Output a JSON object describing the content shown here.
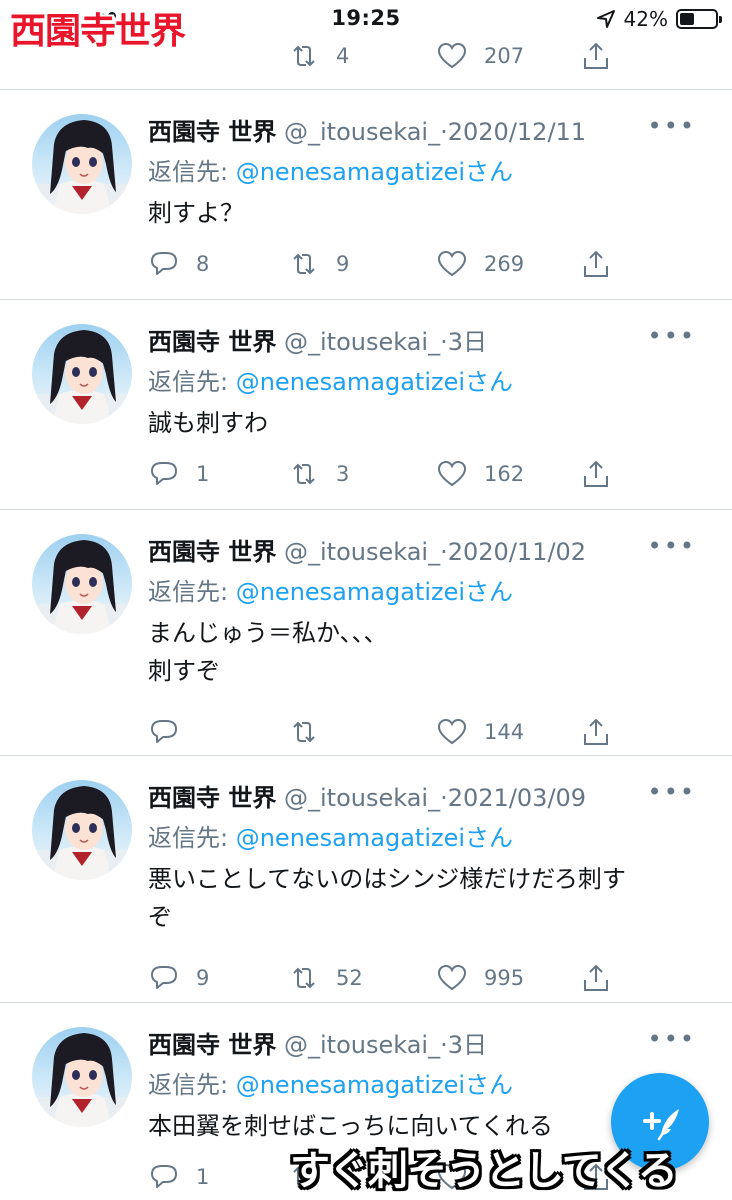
{
  "status_bar": {
    "time": "19:25",
    "battery": "42%",
    "battery_level": 0.42
  },
  "overlay_title": "西園寺世界",
  "caption": "すぐ刺そうとしてくる",
  "partial_tweet": {
    "reply_count": "",
    "retweet_count": "4",
    "like_count": "207"
  },
  "tweets": [
    {
      "name": "西園寺 世界",
      "handle": "@_itousekai_",
      "date": "2020/12/11",
      "reply_label": "返信先: ",
      "reply_to": "@nenesamagatizeiさん",
      "body": [
        "刺すよ？"
      ],
      "reply_count": "8",
      "retweet_count": "9",
      "like_count": "269"
    },
    {
      "name": "西園寺 世界",
      "handle": "@_itousekai_",
      "date": "3日",
      "reply_label": "返信先: ",
      "reply_to": "@nenesamagatizeiさん",
      "body": [
        "誠も刺すわ"
      ],
      "reply_count": "1",
      "retweet_count": "3",
      "like_count": "162"
    },
    {
      "name": "西園寺 世界",
      "handle": "@_itousekai_",
      "date": "2020/11/02",
      "reply_label": "返信先: ",
      "reply_to": "@nenesamagatizeiさん",
      "body": [
        "まんじゅう＝私か、、、",
        "刺すぞ"
      ],
      "reply_count": "",
      "retweet_count": "",
      "like_count": "144"
    },
    {
      "name": "西園寺 世界",
      "handle": "@_itousekai_",
      "date": "2021/03/09",
      "reply_label": "返信先: ",
      "reply_to": "@nenesamagatizeiさん",
      "body": [
        "悪いことしてないのはシンジ様だけだろ刺す",
        "ぞ"
      ],
      "reply_count": "9",
      "retweet_count": "52",
      "like_count": "995"
    },
    {
      "name": "西園寺 世界",
      "handle": "@_itousekai_",
      "date": "3日",
      "reply_label": "返信先: ",
      "reply_to": "@nenesamagatizeiさん",
      "body": [
        "本田翼を刺せばこっちに向いてくれる"
      ],
      "reply_count": "1",
      "retweet_count": "",
      "like_count": "",
      "like_count_hidden": ""
    }
  ],
  "icons": {
    "reply": "reply-icon",
    "retweet": "retweet-icon",
    "like": "heart-icon",
    "share": "share-icon",
    "compose": "compose-tweet-icon",
    "more": "more-icon"
  },
  "colors": {
    "link": "#1da1f2",
    "muted": "#657786",
    "overlay_title": "#e8152b"
  }
}
